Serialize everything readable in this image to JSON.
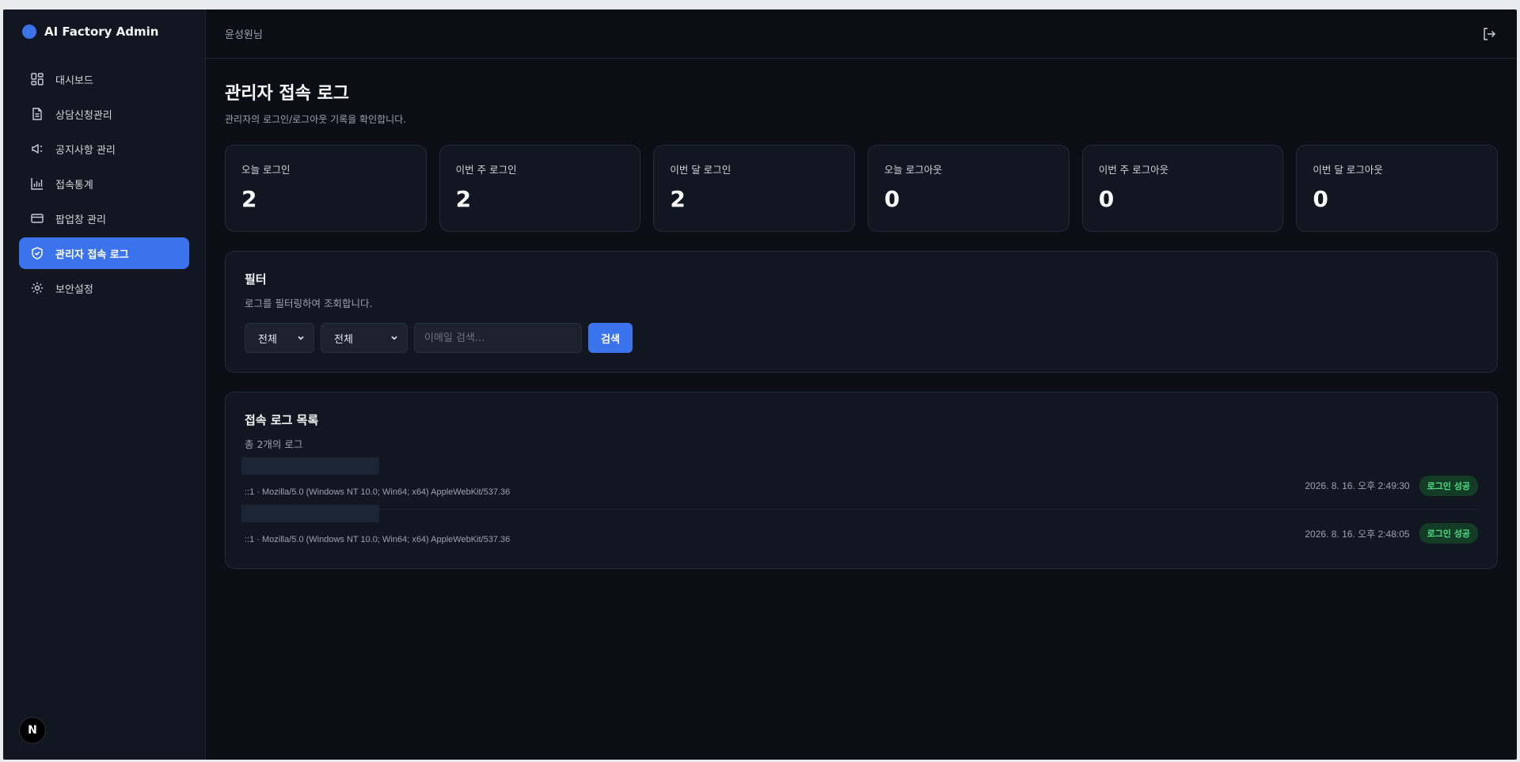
{
  "app": {
    "brand": "AI Factory Admin",
    "brand_color": "#3b73ec"
  },
  "sidebar": {
    "items": [
      {
        "label": "대시보드",
        "icon": "dashboard-icon"
      },
      {
        "label": "상담신청관리",
        "icon": "document-icon"
      },
      {
        "label": "공지사항 관리",
        "icon": "megaphone-icon"
      },
      {
        "label": "접속통계",
        "icon": "bar-chart-icon"
      },
      {
        "label": "팝업창 관리",
        "icon": "card-icon"
      },
      {
        "label": "관리자 접속 로그",
        "icon": "shield-icon",
        "active": true
      },
      {
        "label": "보안설정",
        "icon": "gear-icon"
      }
    ],
    "footer_badge": "N"
  },
  "header": {
    "user": "윤성원님",
    "logout_icon": "logout-icon"
  },
  "page": {
    "title": "관리자 접속 로그",
    "subtitle": "관리자의 로그인/로그아웃 기록을 확인합니다."
  },
  "stats": [
    {
      "label": "오늘 로그인",
      "value": "2"
    },
    {
      "label": "이번 주 로그인",
      "value": "2"
    },
    {
      "label": "이번 달 로그인",
      "value": "2"
    },
    {
      "label": "오늘 로그아웃",
      "value": "0"
    },
    {
      "label": "이번 주 로그아웃",
      "value": "0"
    },
    {
      "label": "이번 달 로그아웃",
      "value": "0"
    }
  ],
  "filter": {
    "title": "필터",
    "subtitle": "로그를 필터링하여 조회합니다.",
    "select1": "전체",
    "select2": "전체",
    "search_placeholder": "이메일 검색...",
    "search_value": "",
    "search_button": "검색"
  },
  "logs": {
    "title": "접속 로그 목록",
    "subtitle": "총 2개의 로그",
    "rows": [
      {
        "ua": "::1 · Mozilla/5.0 (Windows NT 10.0; Win64; x64) AppleWebKit/537.36",
        "time": "2026. 8. 16. 오후 2:49:30",
        "status": "로그인 성공"
      },
      {
        "ua": "::1 · Mozilla/5.0 (Windows NT 10.0; Win64; x64) AppleWebKit/537.36",
        "time": "2026. 8. 16. 오후 2:48:05",
        "status": "로그인 성공"
      }
    ],
    "status_color": "#4ade80"
  }
}
